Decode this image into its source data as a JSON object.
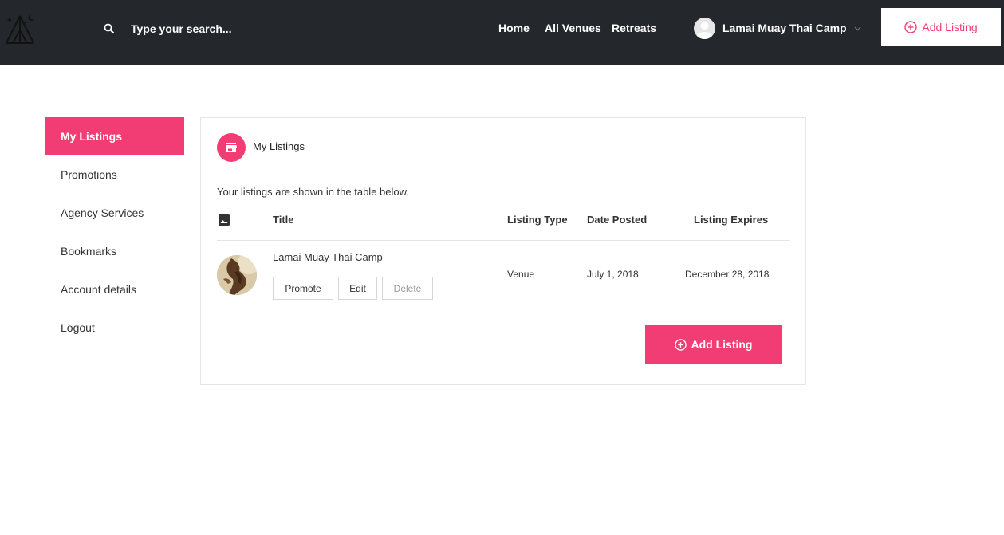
{
  "header": {
    "search_placeholder": "Type your search...",
    "nav": [
      {
        "label": "Home"
      },
      {
        "label": "All Venues"
      },
      {
        "label": "Retreats"
      }
    ],
    "user_name": "Lamai Muay Thai Camp",
    "add_listing_label": "Add Listing"
  },
  "sidebar": {
    "items": [
      {
        "label": "My Listings",
        "active": true
      },
      {
        "label": "Promotions"
      },
      {
        "label": "Agency Services"
      },
      {
        "label": "Bookmarks"
      },
      {
        "label": "Account details"
      },
      {
        "label": "Logout"
      }
    ]
  },
  "panel": {
    "title": "My Listings",
    "description": "Your listings are shown in the table below.",
    "columns": [
      "Title",
      "Listing Type",
      "Date Posted",
      "Listing Expires"
    ],
    "rows": [
      {
        "title": "Lamai Muay Thai Camp",
        "type": "Venue",
        "date_posted": "July 1, 2018",
        "expires": "December 28, 2018",
        "actions": [
          "Promote",
          "Edit",
          "Delete"
        ]
      }
    ],
    "add_listing_label": "Add Listing"
  },
  "colors": {
    "accent": "#f23d74",
    "header_bg": "#24272c"
  }
}
